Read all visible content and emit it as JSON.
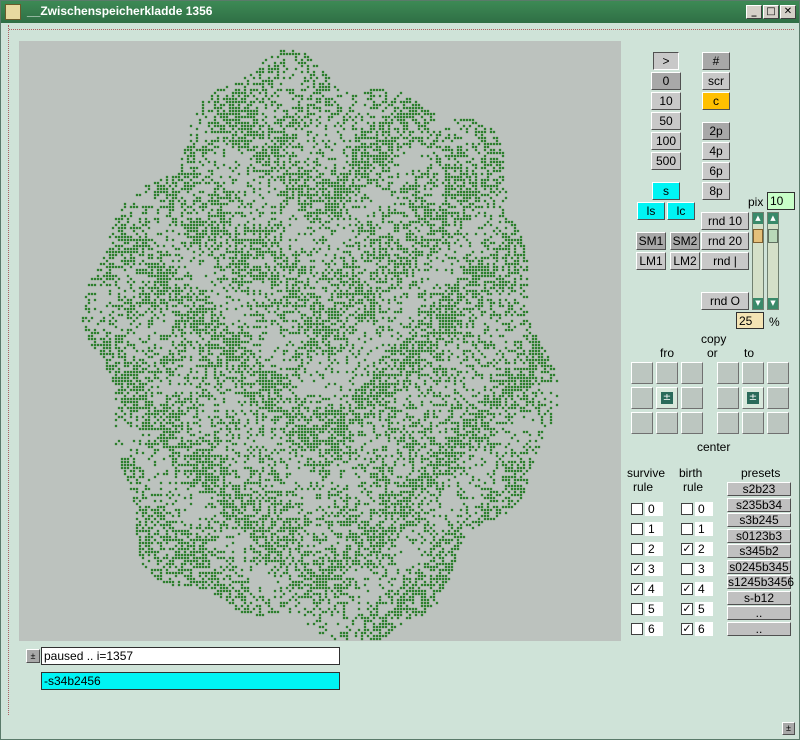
{
  "window": {
    "title": "__Zwischenspeicherkladde 1356",
    "minimize": "_",
    "maximize": "□",
    "close": "✕"
  },
  "speed": {
    "play": ">",
    "zero": "0",
    "ten": "10",
    "fifty": "50",
    "hundred": "100",
    "five_hundred": "500"
  },
  "view": {
    "hash": "#",
    "scr": "scr",
    "c": "c",
    "p2": "2p",
    "p4": "4p",
    "p6": "6p",
    "p8": "8p"
  },
  "store": {
    "s": "s",
    "ls": "ls",
    "lc": "lc",
    "sm1": "SM1",
    "sm2": "SM2",
    "lm1": "LM1",
    "lm2": "LM2"
  },
  "random": {
    "rnd10": "rnd 10",
    "rnd20": "rnd 20",
    "rndbar": "rnd |",
    "rndO": "rnd O"
  },
  "pix": {
    "label": "pix",
    "value": "10"
  },
  "percent": {
    "value": "25",
    "label": "%"
  },
  "copy": {
    "copy": "copy",
    "fro": "fro",
    "or": "or",
    "to": "to",
    "center": "center",
    "center_btn": "±"
  },
  "rules": {
    "survive_label": "survive",
    "birth_label": "birth",
    "rule_label": "rule",
    "presets_label": "presets",
    "numbers": [
      "0",
      "1",
      "2",
      "3",
      "4",
      "5",
      "6"
    ],
    "survive_checked": [
      false,
      false,
      false,
      true,
      true,
      false,
      false
    ],
    "birth_checked": [
      false,
      false,
      true,
      false,
      true,
      true,
      true
    ]
  },
  "presets": [
    "s2b23",
    "s235b34",
    "s3b245",
    "s0123b3",
    "s345b2",
    "s0245b345",
    "s1245b3456",
    "s-b12",
    "..",
    ".."
  ],
  "status": {
    "toggle": "±",
    "text": "paused .. i=1357",
    "rule": "-s34b2456"
  },
  "corner_btn": "±",
  "colors": {
    "cell": "#006a00",
    "canvas": "#bcc2be",
    "background": "#cfe3d8"
  }
}
